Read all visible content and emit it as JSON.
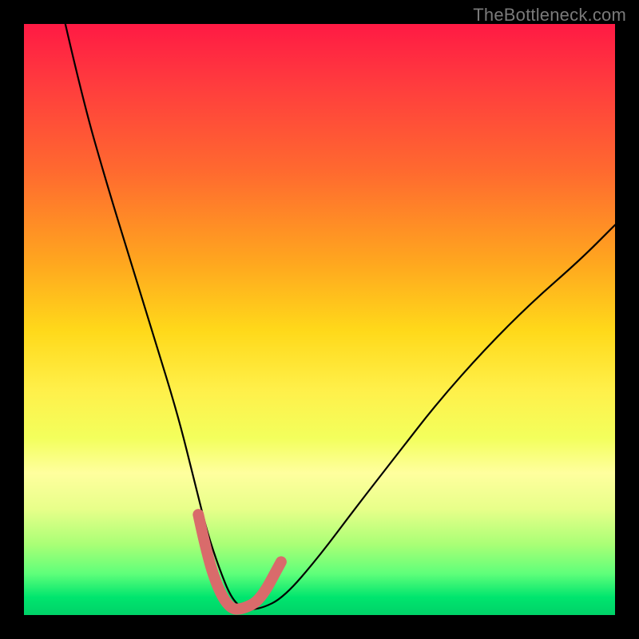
{
  "watermark": "TheBottleneck.com",
  "chart_data": {
    "type": "line",
    "title": "",
    "xlabel": "",
    "ylabel": "",
    "xlim": [
      0,
      100
    ],
    "ylim": [
      0,
      100
    ],
    "series": [
      {
        "name": "bottleneck-curve",
        "x": [
          7,
          10,
          14,
          18,
          22,
          26,
          29,
          31,
          33,
          35,
          37,
          40,
          44,
          50,
          56,
          63,
          70,
          78,
          86,
          94,
          100
        ],
        "values": [
          100,
          87,
          73,
          60,
          47,
          34,
          22,
          14,
          8,
          3,
          1,
          1,
          3,
          10,
          18,
          27,
          36,
          45,
          53,
          60,
          66
        ]
      }
    ],
    "highlight": {
      "name": "valley-highlight",
      "x": [
        29.5,
        31,
        33,
        35,
        37,
        40,
        43.5
      ],
      "values": [
        17,
        10,
        4,
        1,
        1,
        2.5,
        9
      ]
    },
    "colors": {
      "curve": "#000000",
      "highlight": "#d96b6b",
      "gradient_top": "#ff1a44",
      "gradient_bottom": "#00d268"
    }
  }
}
